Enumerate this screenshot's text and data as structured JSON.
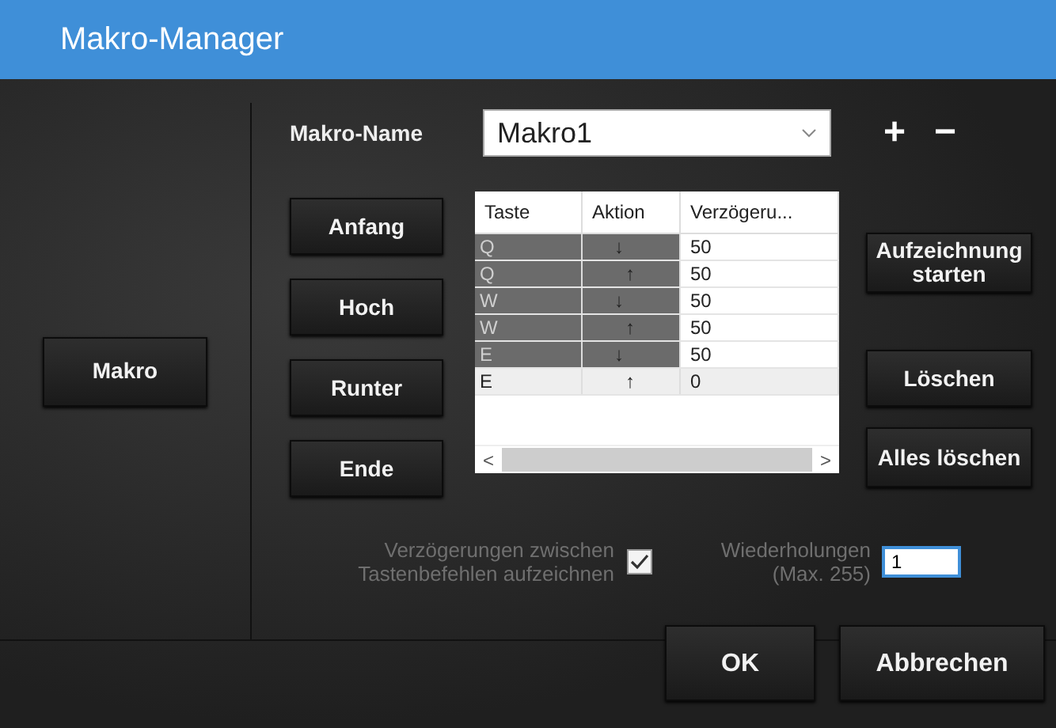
{
  "window": {
    "title": "Makro-Manager"
  },
  "side_button": "Makro",
  "macro_name": {
    "label": "Makro-Name",
    "value": "Makro1",
    "add": "+",
    "remove": "−"
  },
  "nav_buttons": [
    "Anfang",
    "Hoch",
    "Runter",
    "Ende"
  ],
  "table": {
    "columns": [
      "Taste",
      "Aktion",
      "Verzögeru..."
    ],
    "rows": [
      {
        "key": "Q",
        "action": "↓",
        "delay": "50",
        "selected": true
      },
      {
        "key": "Q",
        "action": "↑",
        "delay": "50",
        "selected": true
      },
      {
        "key": "W",
        "action": "↓",
        "delay": "50",
        "selected": true
      },
      {
        "key": "W",
        "action": "↑",
        "delay": "50",
        "selected": true
      },
      {
        "key": "E",
        "action": "↓",
        "delay": "50",
        "selected": true
      },
      {
        "key": "E",
        "action": "↑",
        "delay": "0",
        "selected": false
      }
    ],
    "scroll_left": "<",
    "scroll_right": ">"
  },
  "action_buttons": [
    {
      "label": "Aufzeichnung starten",
      "kind": "record"
    },
    {
      "label": "Löschen",
      "kind": "delete"
    },
    {
      "label": "Alles löschen",
      "kind": "clear"
    }
  ],
  "record_delays": {
    "label": "Verzögerungen zwischen Tastenbefehlen aufzeichnen",
    "checked": true
  },
  "repeats": {
    "label": "Wiederholungen",
    "hint": "(Max. 255)",
    "value": "1"
  },
  "footer_buttons": [
    "OK",
    "Abbrechen"
  ]
}
